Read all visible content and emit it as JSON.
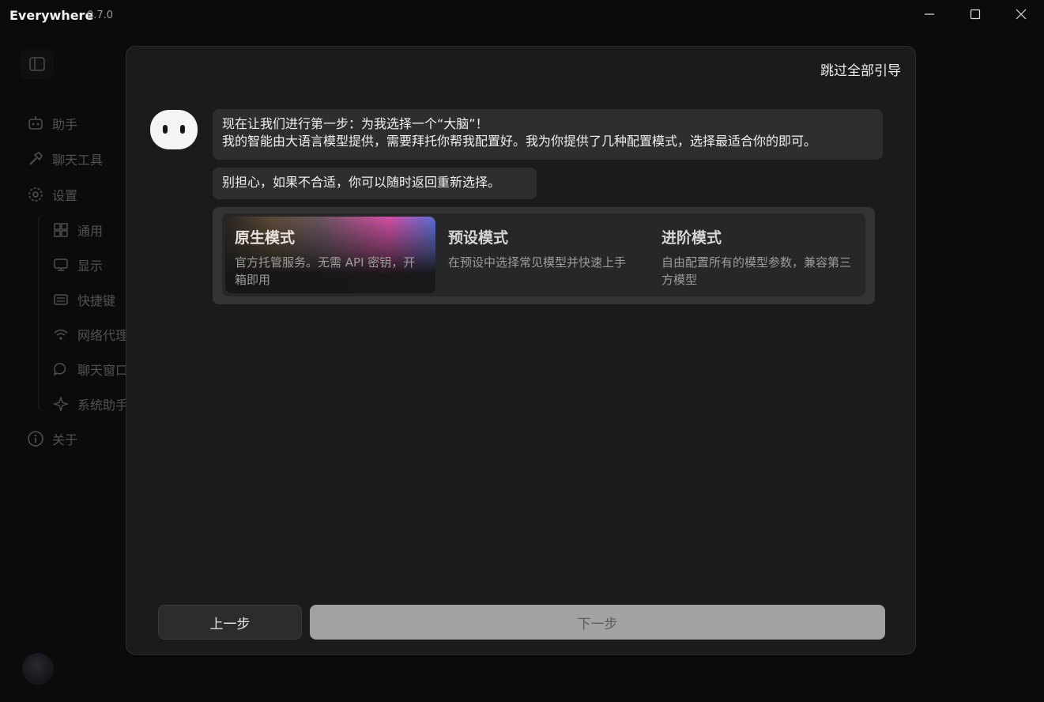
{
  "window": {
    "app_name": "Everywhere",
    "version": "0.7.0"
  },
  "sidebar": {
    "items": [
      {
        "label": "助手",
        "icon": "robot-icon"
      },
      {
        "label": "聊天工具",
        "icon": "hammer-icon"
      },
      {
        "label": "设置",
        "icon": "gear-icon"
      }
    ],
    "settings_items": [
      {
        "label": "通用",
        "icon": "grid-icon"
      },
      {
        "label": "显示",
        "icon": "monitor-icon"
      },
      {
        "label": "快捷键",
        "icon": "keyboard-icon"
      },
      {
        "label": "网络代理",
        "icon": "wifi-icon"
      },
      {
        "label": "聊天窗口",
        "icon": "chat-bubble-icon"
      },
      {
        "label": "系统助手",
        "icon": "sparkle-icon"
      }
    ],
    "about_label": "关于"
  },
  "onboarding": {
    "skip_label": "跳过全部引导",
    "message_1_line_1": "现在让我们进行第一步：为我选择一个“大脑”！",
    "message_1_line_2": "我的智能由大语言模型提供，需要拜托你帮我配置好。我为你提供了几种配置模式，选择最适合你的即可。",
    "message_2": "别担心，如果不合适，你可以随时返回重新选择。",
    "modes": [
      {
        "title": "原生模式",
        "description": "官方托管服务。无需 API 密钥，开箱即用",
        "selected": true
      },
      {
        "title": "预设模式",
        "description": "在预设中选择常见模型并快速上手",
        "selected": false
      },
      {
        "title": "进阶模式",
        "description": "自由配置所有的模型参数，兼容第三方模型",
        "selected": false
      }
    ],
    "prev_label": "上一步",
    "next_label": "下一步"
  }
}
